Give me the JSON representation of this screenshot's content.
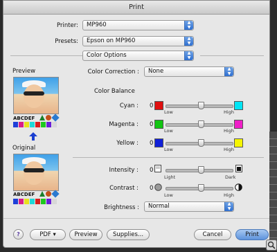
{
  "window": {
    "title": "Print"
  },
  "printer": {
    "label": "Printer:",
    "value": "MP960"
  },
  "presets": {
    "label": "Presets:",
    "value": "Epson on MP960"
  },
  "panel": {
    "value": "Color Options"
  },
  "preview": {
    "label": "Preview",
    "chart_text": "ABCDEF"
  },
  "original": {
    "label": "Original",
    "chart_text": "ABCDEF"
  },
  "color_correction": {
    "label": "Color Correction :",
    "value": "None"
  },
  "color_balance": {
    "title": "Color Balance"
  },
  "sliders": {
    "cyan": {
      "label": "Cyan :",
      "value": "0",
      "low": "Low",
      "high": "High",
      "high_color": "#00e5f5",
      "low_color": "#e01010"
    },
    "magenta": {
      "label": "Magenta :",
      "value": "0",
      "low": "Low",
      "high": "High",
      "high_color": "#f01ec8",
      "low_color": "#12c512"
    },
    "yellow": {
      "label": "Yellow :",
      "value": "0",
      "low": "Low",
      "high": "High",
      "high_color": "#f5f500",
      "low_color": "#1020d8"
    },
    "intensity": {
      "label": "Intensity :",
      "value": "0",
      "low": "Light",
      "high": "Dark"
    },
    "contrast": {
      "label": "Contrast :",
      "value": "0",
      "low": "Low",
      "high": "High"
    }
  },
  "brightness": {
    "label": "Brightness :",
    "value": "Normal"
  },
  "buttons": {
    "help": "?",
    "pdf": "PDF ▾",
    "preview": "Preview",
    "supplies": "Supplies...",
    "cancel": "Cancel",
    "print": "Print"
  },
  "colors": {
    "accent": "#3a74d4",
    "dialog_bg": "#e7e7e7"
  },
  "icons": {
    "up_arrow": "up-arrow-icon"
  }
}
